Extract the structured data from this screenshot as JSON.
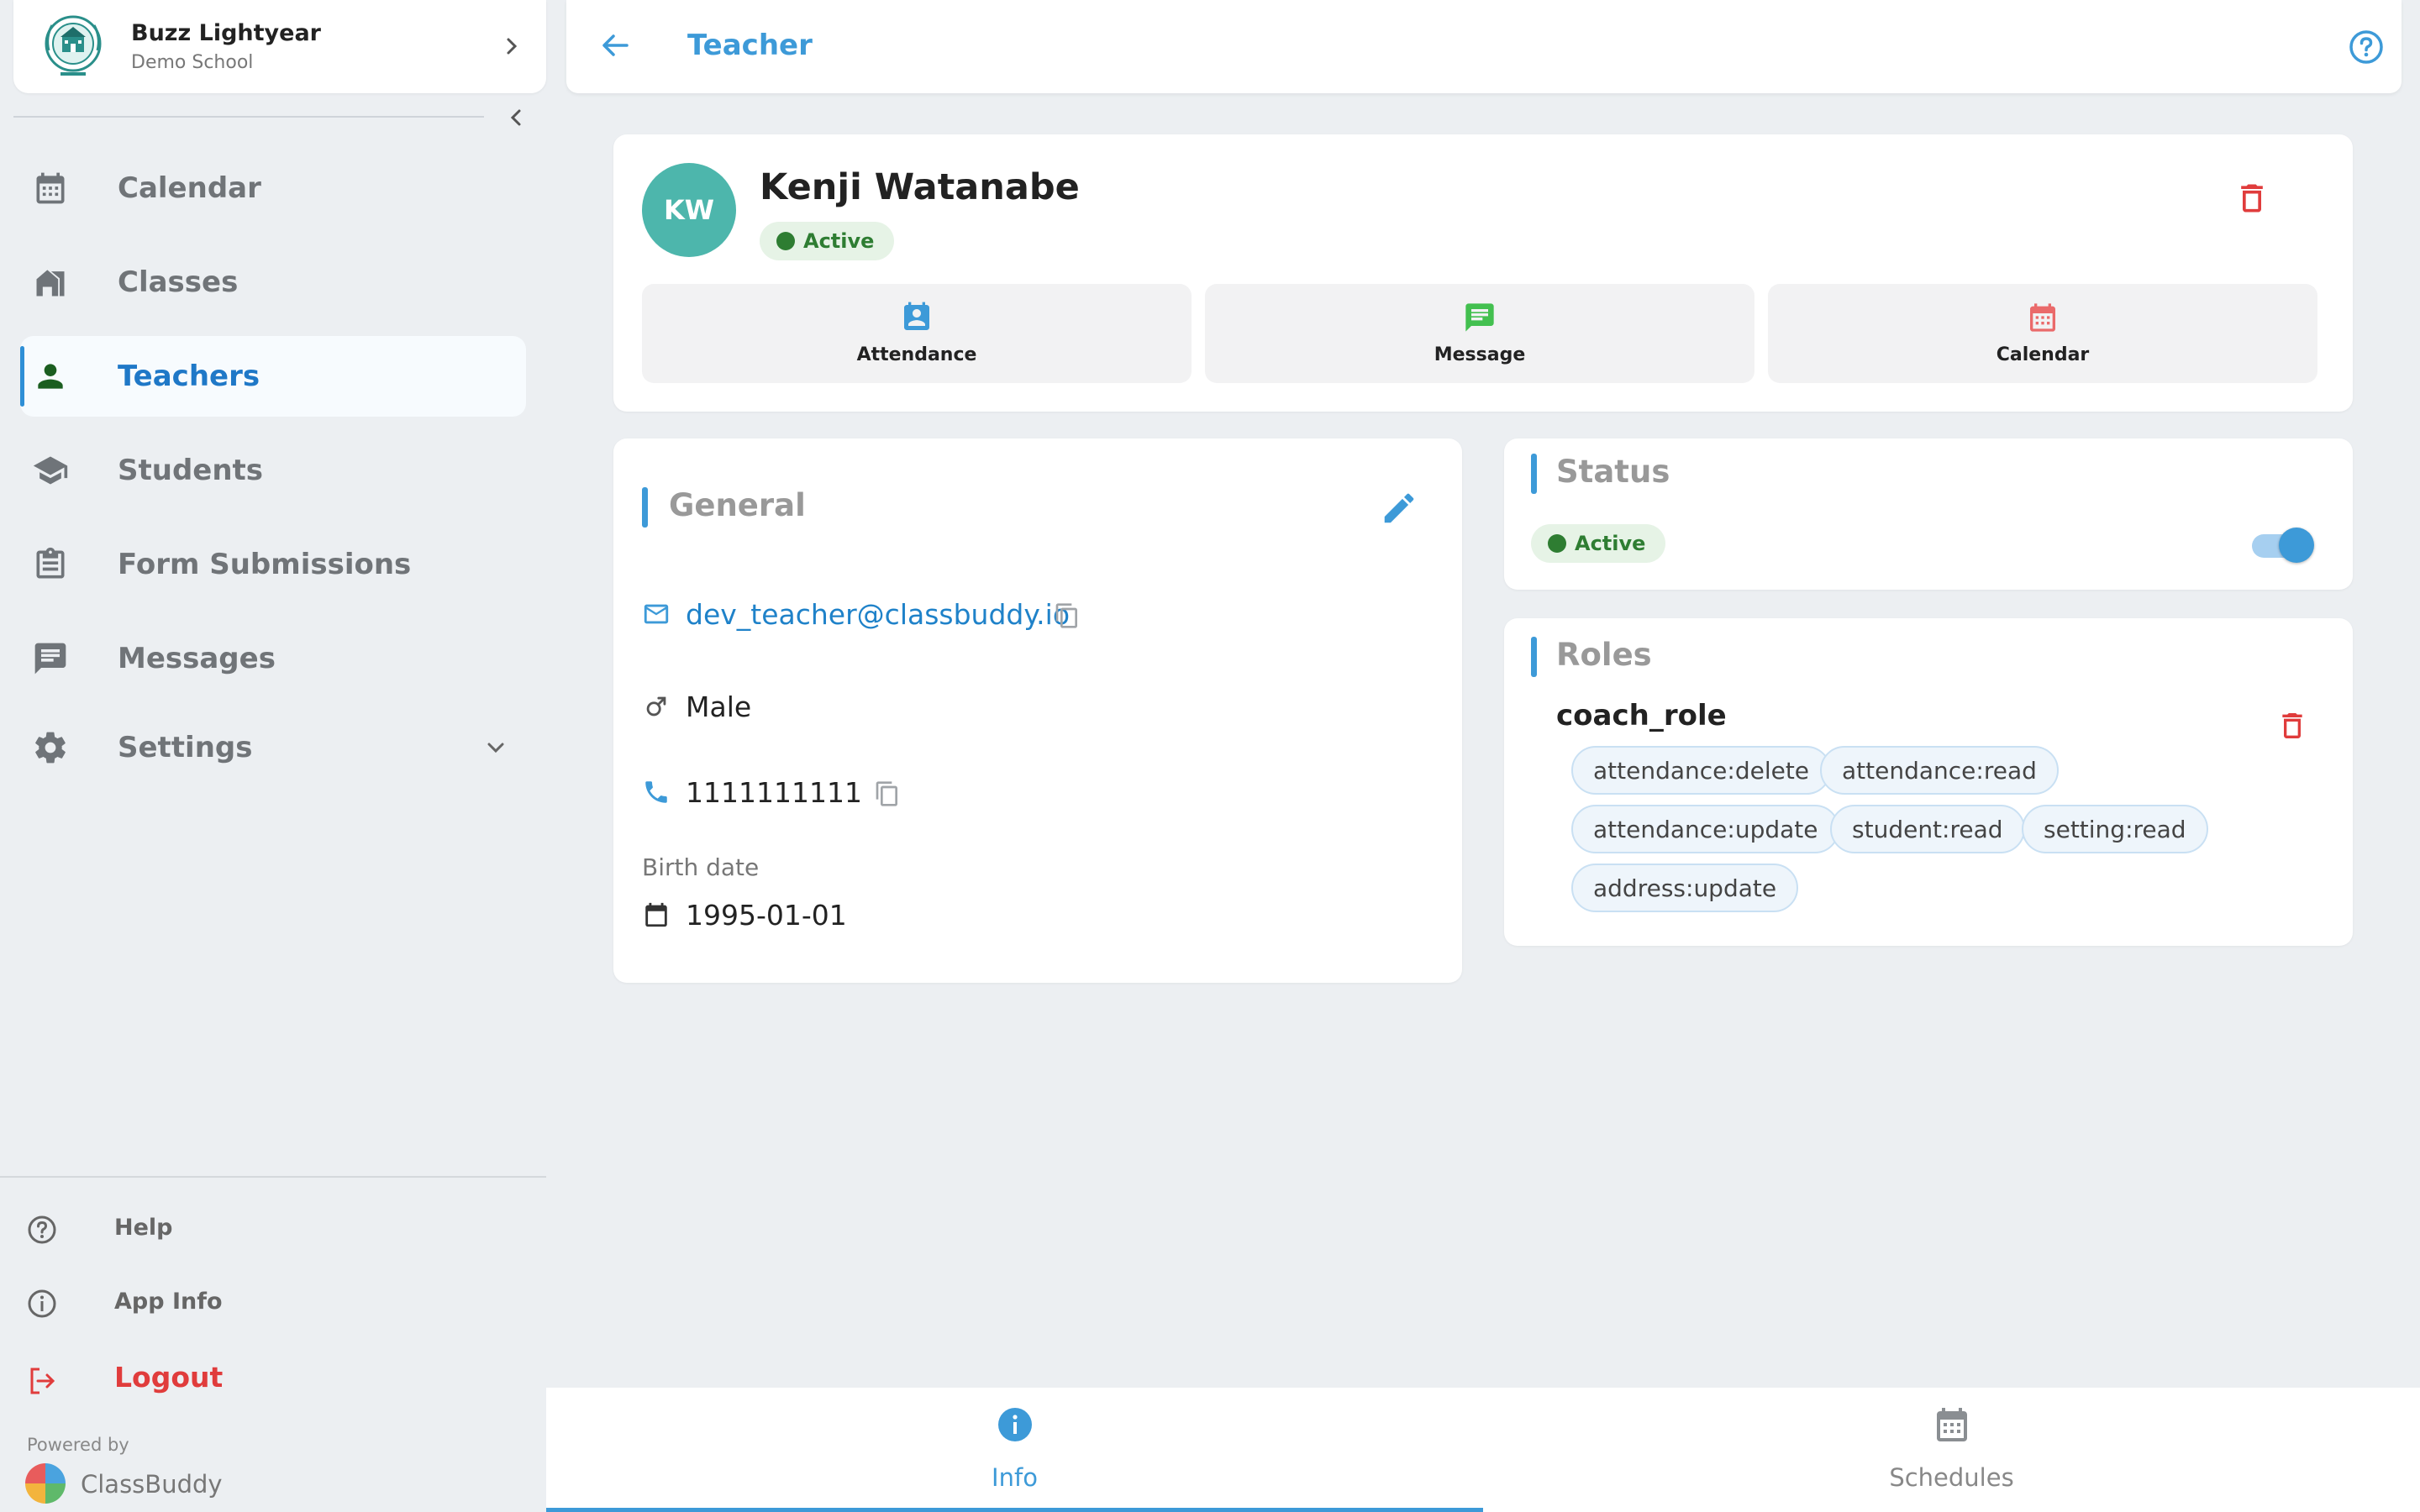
{
  "school": {
    "name": "Buzz Lightyear",
    "subtitle": "Demo School",
    "logo_icon": "school-crest-icon"
  },
  "sidebar": {
    "items": [
      {
        "label": "Calendar",
        "icon": "calendar-icon",
        "active": false
      },
      {
        "label": "Classes",
        "icon": "classes-building-icon",
        "active": false
      },
      {
        "label": "Teachers",
        "icon": "teacher-person-icon",
        "active": true
      },
      {
        "label": "Students",
        "icon": "graduation-cap-icon",
        "active": false
      },
      {
        "label": "Form Submissions",
        "icon": "clipboard-icon",
        "active": false
      },
      {
        "label": "Messages",
        "icon": "message-icon",
        "active": false
      },
      {
        "label": "Settings",
        "icon": "gear-icon",
        "active": false
      }
    ],
    "bottom": {
      "help": "Help",
      "app_info": "App Info",
      "logout": "Logout"
    },
    "powered_by": "Powered by",
    "brand": "ClassBuddy"
  },
  "header": {
    "title": "Teacher"
  },
  "profile": {
    "initials": "KW",
    "name": "Kenji Watanabe",
    "status": "Active",
    "actions": [
      {
        "label": "Attendance",
        "icon": "attendance-badge-icon"
      },
      {
        "label": "Message",
        "icon": "message-icon"
      },
      {
        "label": "Calendar",
        "icon": "calendar-icon"
      }
    ]
  },
  "general": {
    "title": "General",
    "email": "dev_teacher@classbuddy.io",
    "gender": "Male",
    "phone": "1111111111",
    "birth_label": "Birth date",
    "birth_date": "1995-01-01"
  },
  "status": {
    "title": "Status",
    "value": "Active",
    "toggle_on": true
  },
  "roles": {
    "title": "Roles",
    "role_name": "coach_role",
    "permissions": [
      "attendance:delete",
      "attendance:read",
      "attendance:update",
      "student:read",
      "setting:read",
      "address:update"
    ]
  },
  "tabs": [
    {
      "label": "Info",
      "icon": "info-icon",
      "active": true
    },
    {
      "label": "Schedules",
      "icon": "calendar-icon",
      "active": false
    }
  ],
  "colors": {
    "accent": "#3d9ad8",
    "active_green": "#2e7d32",
    "danger": "#e03c3c",
    "avatar": "#4db6ac"
  }
}
